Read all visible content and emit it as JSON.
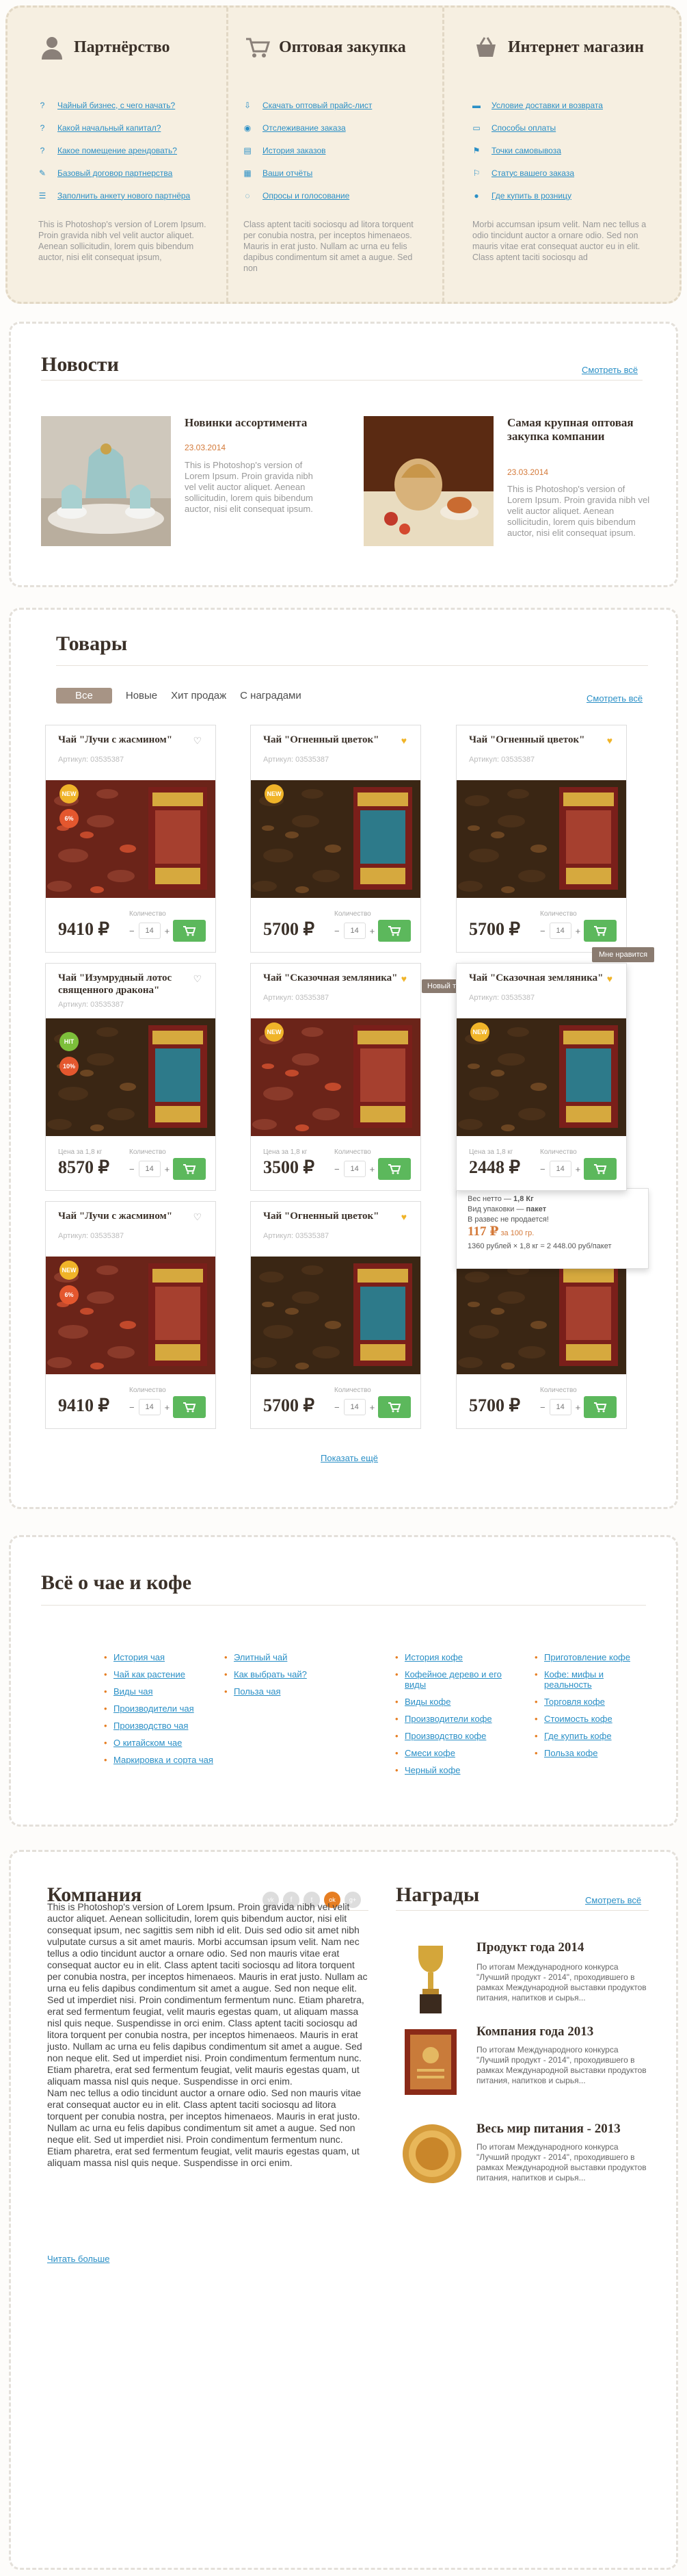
{
  "top": {
    "sections": [
      {
        "title": "Партнёрство",
        "icon": "user-icon",
        "links": [
          "Чайный бизнес, с чего начать?",
          "Какой начальный капитал?",
          "Какое помещение арендовать?",
          "Базовый договор партнерства",
          "Заполнить анкету нового партнёра"
        ],
        "text": "This is Photoshop's version  of Lorem Ipsum. Proin gravida nibh vel velit auctor aliquet. Aenean sollicitudin, lorem quis bibendum auctor, nisi elit consequat ipsum,"
      },
      {
        "title": "Оптовая закупка",
        "icon": "cart-icon",
        "links": [
          "Скачать оптовый прайс-лист",
          "Отслеживание заказа",
          "История заказов",
          "Ваши отчёты",
          "Опросы и голосование"
        ],
        "text": "Class aptent taciti sociosqu ad litora torquent per conubia nostra, per inceptos himenaeos. Mauris in erat justo. Nullam ac urna eu felis dapibus condimentum sit amet a augue. Sed non"
      },
      {
        "title": "Интернет магазин",
        "icon": "basket-icon",
        "links": [
          "Условие доставки и возврата",
          "Способы оплаты",
          "Точки самовывоза",
          "Статус вашего заказа",
          "Где купить в розницу"
        ],
        "text": "Morbi accumsan ipsum velit. Nam nec tellus a odio tincidunt auctor a ornare odio. Sed non  mauris vitae erat consequat auctor eu in elit. Class aptent taciti sociosqu ad"
      }
    ]
  },
  "news": {
    "title": "Новости",
    "see_all": "Смотреть всё",
    "items": [
      {
        "title": "Новинки ассортимента",
        "date": "23.03.2014",
        "text": "This is Photoshop's version  of Lorem Ipsum. Proin gravida nibh vel velit auctor aliquet. Aenean sollicitudin, lorem quis bibendum auctor, nisi elit consequat ipsum."
      },
      {
        "title": "Самая крупная оптовая закупка компании",
        "date": "23.03.2014",
        "text": "This is Photoshop's version  of Lorem Ipsum. Proin gravida nibh vel velit auctor aliquet. Aenean sollicitudin, lorem quis bibendum auctor, nisi elit consequat ipsum."
      }
    ]
  },
  "products": {
    "title": "Товары",
    "see_all": "Смотреть всё",
    "tabs": [
      "Все",
      "Новые",
      "Хит продаж",
      "С наградами"
    ],
    "qty_label": "Количество",
    "price_per_g": "Цена за 1,8 кг",
    "show_more": "Показать ещё",
    "tooltip_new": "Новый товар 12.09.2014",
    "tooltip_like": "Мне нравится",
    "items": [
      {
        "name": "Чай \"Лучи с жасмином\"",
        "article": "Артикул: 03535387",
        "price": "9410 ₽",
        "qty": "14",
        "badges": [
          "NEW",
          "6%"
        ],
        "leaf": "red"
      },
      {
        "name": "Чай \"Огненный цветок\"",
        "article": "Артикул: 03535387",
        "price": "5700 ₽",
        "qty": "14",
        "badges": [
          "NEW"
        ],
        "leaf": "dark"
      },
      {
        "name": "Чай \"Огненный цветок\"",
        "article": "Артикул: 03535387",
        "price": "5700 ₽",
        "qty": "14",
        "badges": [],
        "leaf": "dark"
      },
      {
        "name": "Чай \"Изумрудный лотос священного дракона\"",
        "article": "Артикул: 03535387",
        "price": "8570 ₽",
        "qty": "14",
        "badges": [
          "HIT",
          "10%"
        ],
        "leaf": "dark"
      },
      {
        "name": "Чай \"Сказочная земляника\"",
        "article": "Артикул: 03535387",
        "price": "3500 ₽",
        "qty": "14",
        "badges": [
          "NEW"
        ],
        "leaf": "red"
      },
      {
        "name": "Чай \"Сказочная земляника\"",
        "article": "Артикул: 03535387",
        "price": "2448 ₽",
        "qty": "14",
        "badges": [
          "NEW"
        ],
        "leaf": "dark"
      },
      {
        "name": "Чай \"Лучи с жасмином\"",
        "article": "Артикул: 03535387",
        "price": "9410 ₽",
        "qty": "14",
        "badges": [
          "NEW",
          "6%"
        ],
        "leaf": "red"
      },
      {
        "name": "Чай \"Огненный цветок\"",
        "article": "Артикул: 03535387",
        "price": "5700 ₽",
        "qty": "14",
        "badges": [],
        "leaf": "dark"
      },
      {
        "name": "Чай \"Огненный цветок\"",
        "article": "Артикул: 03535387",
        "price": "5700 ₽",
        "qty": "14",
        "badges": [],
        "leaf": "dark"
      }
    ],
    "hover_info": {
      "weight_label": "Вес нетто —",
      "weight": "1,8 Кг",
      "pack_label": "Вид упаковки —",
      "pack": "пакет",
      "no_retail": "В развес не продается!",
      "unit_price": "117 ₽",
      "unit": "за 100 гр.",
      "calc": "1360 рублей × 1,8 кг = 2 448.00 руб/пакет"
    }
  },
  "tea": {
    "title": "Всё о чае и кофе",
    "cols": [
      [
        "История чая",
        "Чай как растение",
        "Виды чая",
        "Производители чая",
        "Производство чая",
        "О китайском чае",
        "Маркировка и сорта чая"
      ],
      [
        "Элитный чай",
        "Как выбрать чай?",
        "Польза чая"
      ],
      [
        "История кофе",
        "Кофейное дерево и его виды",
        "Виды кофе",
        "Производители кофе",
        "Производство кофе",
        "Смеси кофе",
        "Черный кофе"
      ],
      [
        "Приготовление кофе",
        "Кофе: мифы и реальность",
        "Торговля кофе",
        "Стоимость кофе",
        "Где купить кофе",
        "Польза кофе"
      ]
    ]
  },
  "company": {
    "title": "Компания",
    "text": "This is Photoshop's version  of Lorem Ipsum. Proin gravida nibh vel velit auctor aliquet. Aenean sollicitudin, lorem quis bibendum auctor, nisi elit consequat ipsum, nec sagittis sem nibh id elit. Duis sed odio sit amet nibh vulputate cursus a sit amet mauris. Morbi accumsan ipsum velit. Nam nec tellus a odio tincidunt auctor a ornare odio. Sed non  mauris vitae erat consequat auctor eu in elit. Class aptent taciti sociosqu ad litora torquent per conubia nostra, per inceptos himenaeos. Mauris in erat justo. Nullam ac urna eu felis dapibus condimentum sit amet a augue. Sed non neque elit. Sed ut imperdiet nisi. Proin condimentum fermentum nunc. Etiam pharetra, erat sed fermentum feugiat, velit mauris egestas quam, ut aliquam massa nisl quis neque. Suspendisse in orci enim. Class aptent taciti sociosqu ad litora torquent per conubia nostra, per inceptos himenaeos. Mauris in erat justo. Nullam ac urna eu felis dapibus condimentum sit amet a augue. Sed non neque elit. Sed ut imperdiet nisi. Proin condimentum fermentum nunc. Etiam pharetra, erat sed fermentum feugiat, velit mauris egestas quam, ut aliquam massa nisl quis neque. Suspendisse in orci enim.",
    "text2": "Nam nec tellus a odio tincidunt auctor a ornare odio. Sed non  mauris vitae erat consequat auctor eu in elit. Class aptent taciti sociosqu ad litora torquent per conubia nostra, per inceptos himenaeos. Mauris in erat justo. Nullam ac urna eu felis dapibus condimentum sit amet a augue. Sed non neque elit. Sed ut imperdiet nisi. Proin condimentum fermentum nunc. Etiam pharetra, erat sed fermentum feugiat, velit mauris egestas quam, ut aliquam massa nisl quis neque. Suspendisse in orci enim.",
    "read_more": "Читать больше",
    "social": [
      "vk",
      "f",
      "t",
      "ok",
      "g+"
    ]
  },
  "awards": {
    "title": "Награды",
    "see_all": "Смотреть всё",
    "items": [
      {
        "title": "Продукт года 2014",
        "text": "По итогам Международного конкурса \"Лучший продукт - 2014\", проходившего в рамках Международной выставки продуктов питания, напитков и сырья..."
      },
      {
        "title": "Компания года 2013",
        "text": "По итогам Международного конкурса \"Лучший продукт - 2014\", проходившего в рамках Международной выставки продуктов питания, напитков и сырья..."
      },
      {
        "title": "Весь мир питания - 2013",
        "text": "По итогам Международного конкурса \"Лучший продукт - 2014\", проходившего в рамках Международной выставки продуктов питания, напитков и сырья..."
      }
    ]
  },
  "colors": {
    "accent": "#2a8fc6",
    "brown": "#3b3129",
    "green": "#5cb85c",
    "beige": "#f6efe1",
    "orange": "#e67e22"
  }
}
